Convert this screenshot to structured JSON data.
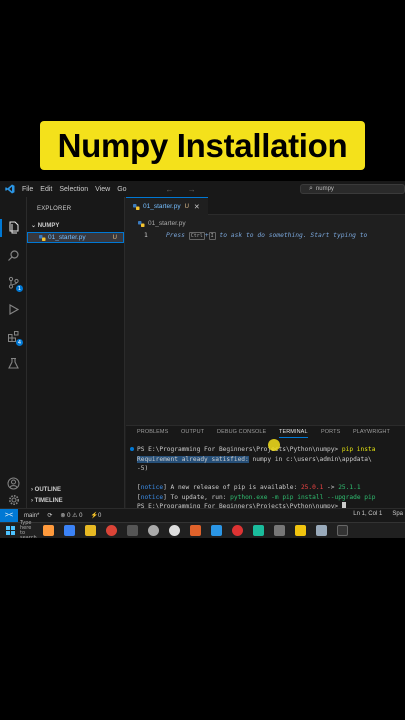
{
  "banner": {
    "title": "Numpy Installation"
  },
  "titlebar": {
    "menu": [
      "File",
      "Edit",
      "Selection",
      "View",
      "Go"
    ],
    "nav_arrows": "← →",
    "search_text": "numpy"
  },
  "sidebar": {
    "title": "EXPLORER",
    "folder": "NUMPY",
    "file_name": "01_starter.py",
    "file_status": "U",
    "sections": [
      "OUTLINE",
      "TIMELINE"
    ]
  },
  "activity_badges": {
    "source_control": "1",
    "extensions": "4"
  },
  "editor": {
    "tab_name": "01_starter.py",
    "tab_status": "U",
    "breadcrumb": "01_starter.py",
    "line_number": "1",
    "hint_press": "Press",
    "hint_key1": "Ctrl",
    "hint_plus": "+",
    "hint_key2": "I",
    "hint_rest": "to ask to do something. Start typing to"
  },
  "panel": {
    "tabs": [
      "PROBLEMS",
      "OUTPUT",
      "DEBUG CONSOLE",
      "TERMINAL",
      "PORTS",
      "PLAYWRIGHT"
    ],
    "active_tab": "TERMINAL",
    "terminal": {
      "line1_prompt": "PS E:\\Programming For Beginners\\Projects\\Python\\numpy> ",
      "line1_cmd": "pip insta",
      "line2_selected": "Requirement already satisfied:",
      "line2_rest": " numpy in c:\\users\\admin\\appdata\\",
      "line3": "-5)",
      "notice_label": "notice",
      "line5_text": " A new release of pip is available: ",
      "line5_old": "25.0.1",
      "line5_arrow": " -> ",
      "line5_new": "25.1.1",
      "line6_text": " To update, run: ",
      "line6_cmd": "python.exe -m pip install --upgrade pip",
      "line7_prompt": "PS E:\\Programming For Beginners\\Projects\\Python\\numpy> "
    }
  },
  "statusbar": {
    "remote_icon": "><",
    "branch": "main*",
    "sync": "⟳",
    "errors": "⊗ 0 ⚠ 0",
    "ports": "⚡0",
    "position": "Ln 1, Col 1",
    "spaces": "Spa"
  },
  "taskbar": {
    "search_label": "Type here to search"
  },
  "colors": {
    "banner_bg": "#f4e11b",
    "accent_blue": "#0078d4",
    "editor_bg": "#1f1f1f",
    "terminal_green": "#2fbf71",
    "terminal_red": "#e44"
  }
}
